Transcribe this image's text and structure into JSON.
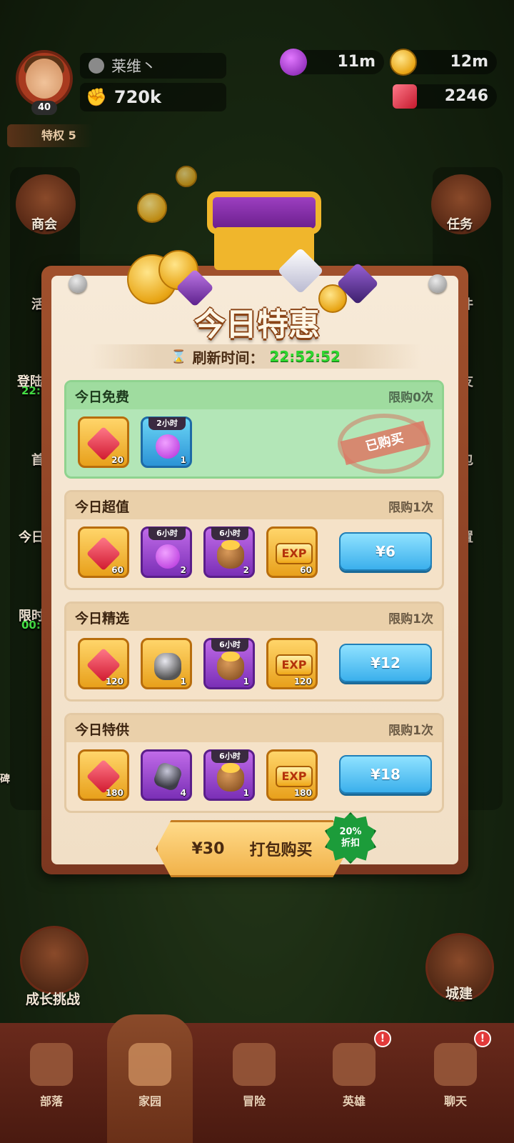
{
  "player": {
    "name": "莱维丶",
    "level": "40",
    "power": "720k",
    "privilege": "特权 5"
  },
  "resources": {
    "elixir": "11m",
    "gold": "12m",
    "gems": "2246"
  },
  "side_left": [
    "商会",
    "活",
    "登陆",
    "22:",
    "首",
    "今日",
    "限时",
    "00:"
  ],
  "side_right": [
    "任务",
    "件",
    "友",
    "包",
    "置"
  ],
  "modal": {
    "title": "今日特惠",
    "refresh_label": "刷新时间：",
    "refresh_time": "22:52:52",
    "sections": [
      {
        "title": "今日免费",
        "limit": "限购0次",
        "stamp": "已购买",
        "items": [
          {
            "icon": "ruby-icon",
            "qty": "20",
            "tag": ""
          },
          {
            "icon": "potion-icon",
            "qty": "1",
            "tag": "2小时"
          }
        ]
      },
      {
        "title": "今日超值",
        "limit": "限购1次",
        "price": "¥6",
        "items": [
          {
            "icon": "ruby-icon",
            "qty": "60",
            "tag": ""
          },
          {
            "icon": "potion-icon",
            "qty": "2",
            "tag": "6小时"
          },
          {
            "icon": "gold-bag-icon",
            "qty": "2",
            "tag": "6小时"
          },
          {
            "icon": "exp-icon",
            "qty": "60",
            "tag": ""
          }
        ]
      },
      {
        "title": "今日精选",
        "limit": "限购1次",
        "price": "¥12",
        "items": [
          {
            "icon": "ruby-icon",
            "qty": "120",
            "tag": ""
          },
          {
            "icon": "ore-icon",
            "qty": "1",
            "tag": ""
          },
          {
            "icon": "gold-bag-icon",
            "qty": "1",
            "tag": "6小时"
          },
          {
            "icon": "exp-icon",
            "qty": "120",
            "tag": ""
          }
        ]
      },
      {
        "title": "今日特供",
        "limit": "限购1次",
        "price": "¥18",
        "items": [
          {
            "icon": "ruby-icon",
            "qty": "180",
            "tag": ""
          },
          {
            "icon": "crystal-icon",
            "qty": "4",
            "tag": ""
          },
          {
            "icon": "gold-bag-icon",
            "qty": "1",
            "tag": "6小时"
          },
          {
            "icon": "exp-icon",
            "qty": "180",
            "tag": ""
          }
        ]
      }
    ],
    "exp_text": "EXP",
    "bundle_price": "¥30",
    "bundle_label": "打包购买",
    "discount_pct": "20%",
    "discount_text": "折扣"
  },
  "features": {
    "growth": "成长挑战",
    "build": "城建",
    "left_edge": "碑"
  },
  "tabs": [
    {
      "label": "部落",
      "alert": ""
    },
    {
      "label": "家园",
      "alert": ""
    },
    {
      "label": "冒险",
      "alert": ""
    },
    {
      "label": "英雄",
      "alert": "!"
    },
    {
      "label": "聊天",
      "alert": "!"
    }
  ]
}
